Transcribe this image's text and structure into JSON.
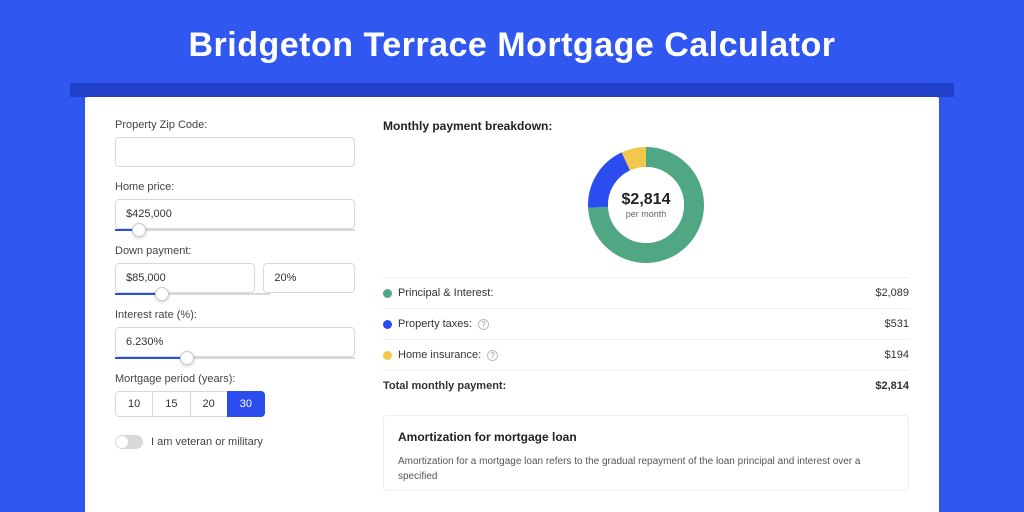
{
  "title": "Bridgeton Terrace Mortgage Calculator",
  "colors": {
    "green": "#4fa783",
    "blue": "#2b4df0",
    "yellow": "#f2c84c"
  },
  "left": {
    "zip": {
      "label": "Property Zip Code:",
      "value": ""
    },
    "home_price": {
      "label": "Home price:",
      "value": "$425,000",
      "slider_pct": 10
    },
    "down_payment": {
      "label": "Down payment:",
      "amount": "$85,000",
      "percent": "20%",
      "slider_pct": 20
    },
    "interest": {
      "label": "Interest rate (%):",
      "value": "6.230%",
      "slider_pct": 30
    },
    "period": {
      "label": "Mortgage period (years):",
      "options": [
        "10",
        "15",
        "20",
        "30"
      ],
      "selected": "30"
    },
    "veteran": {
      "label": "I am veteran or military"
    }
  },
  "right": {
    "breakdown_title": "Monthly payment breakdown:",
    "donut": {
      "value": "$2,814",
      "sub": "per month"
    },
    "lines": [
      {
        "color": "#4fa783",
        "label": "Principal & Interest:",
        "help": false,
        "amount": "$2,089"
      },
      {
        "color": "#2b4df0",
        "label": "Property taxes:",
        "help": true,
        "amount": "$531"
      },
      {
        "color": "#f2c84c",
        "label": "Home insurance:",
        "help": true,
        "amount": "$194"
      }
    ],
    "total": {
      "label": "Total monthly payment:",
      "amount": "$2,814"
    },
    "amort": {
      "title": "Amortization for mortgage loan",
      "text": "Amortization for a mortgage loan refers to the gradual repayment of the loan principal and interest over a specified"
    }
  },
  "chart_data": {
    "type": "pie",
    "title": "Monthly payment breakdown",
    "series": [
      {
        "name": "Principal & Interest",
        "value": 2089,
        "color": "#4fa783"
      },
      {
        "name": "Property taxes",
        "value": 531,
        "color": "#2b4df0"
      },
      {
        "name": "Home insurance",
        "value": 194,
        "color": "#f2c84c"
      }
    ],
    "total": 2814,
    "center_label": "$2,814 per month"
  }
}
